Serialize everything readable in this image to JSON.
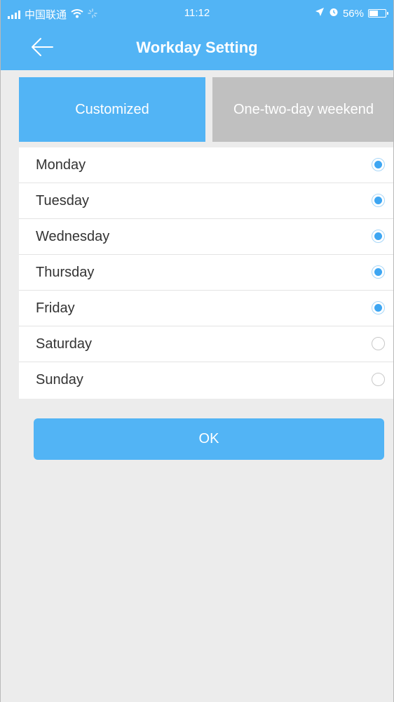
{
  "status_bar": {
    "carrier": "中国联通",
    "time": "11:12",
    "battery": "56%",
    "battery_level": 0.56,
    "icons": [
      "signal-icon",
      "wifi-icon",
      "loading-icon",
      "location-icon",
      "alarm-icon",
      "battery-icon"
    ]
  },
  "nav": {
    "title": "Workday Setting",
    "back_icon": "back-arrow-icon"
  },
  "tabs": [
    {
      "label": "Customized",
      "active": true
    },
    {
      "label": "One-two-day weekend",
      "active": false
    }
  ],
  "days": [
    {
      "label": "Monday",
      "checked": true
    },
    {
      "label": "Tuesday",
      "checked": true
    },
    {
      "label": "Wednesday",
      "checked": true
    },
    {
      "label": "Thursday",
      "checked": true
    },
    {
      "label": "Friday",
      "checked": true
    },
    {
      "label": "Saturday",
      "checked": false
    },
    {
      "label": "Sunday",
      "checked": false
    }
  ],
  "ok_button": {
    "label": "OK"
  },
  "colors": {
    "accent": "#52b4f5",
    "radio_on": "#3ea6f2",
    "inactive_tab": "#c0c0c0",
    "background": "#ececec"
  }
}
